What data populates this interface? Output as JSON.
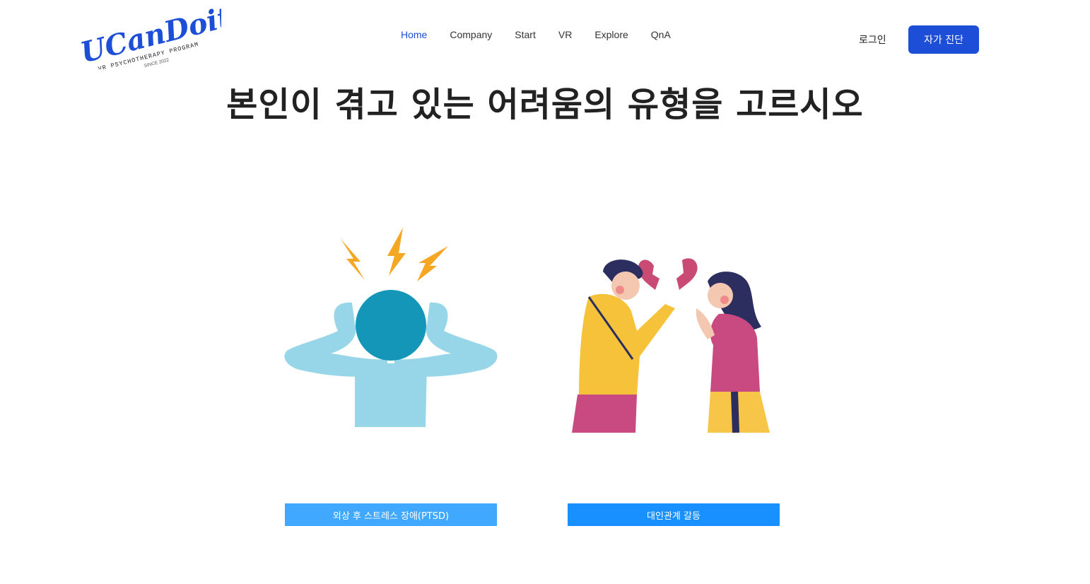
{
  "brand": {
    "logo_text": "UCanDoit!",
    "tagline": "VR PSYCHOTHERAPY PROGRAM",
    "since": "SINCE 2022"
  },
  "nav": {
    "items": [
      {
        "label": "Home",
        "active": true
      },
      {
        "label": "Company",
        "active": false
      },
      {
        "label": "Start",
        "active": false
      },
      {
        "label": "VR",
        "active": false
      },
      {
        "label": "Explore",
        "active": false
      },
      {
        "label": "QnA",
        "active": false
      }
    ]
  },
  "header": {
    "login_label": "로그인",
    "cta_label": "자가 진단"
  },
  "main": {
    "title": "본인이 겪고 있는 어려움의 유형을 고르시오",
    "options": [
      {
        "label": "외상 후 스트레스 장애(PTSD)",
        "image": "stressed-person-illustration"
      },
      {
        "label": "대인관계 갈등",
        "image": "arguing-couple-illustration"
      }
    ]
  },
  "colors": {
    "accent": "#1d4ed8",
    "option_button_1": "#40a9ff",
    "option_button_2": "#1890ff"
  }
}
